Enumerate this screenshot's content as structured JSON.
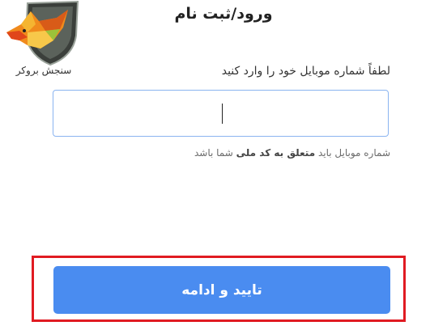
{
  "header": {
    "title": "ورود/ثبت نام"
  },
  "logo": {
    "text": "سنجش بروکر",
    "icon": "fox-shield-logo"
  },
  "form": {
    "prompt_label": "لطفاً شماره موبایل خود را وارد کنید",
    "phone_value": "",
    "hint_prefix": "شماره موبایل باید ",
    "hint_bold": "متعلق به کد ملی",
    "hint_suffix": " شما باشد",
    "submit_label": "تایید و ادامه"
  },
  "colors": {
    "button": "#4a8cf0",
    "input_border": "#8ab4f0",
    "highlight": "#e01b22"
  }
}
